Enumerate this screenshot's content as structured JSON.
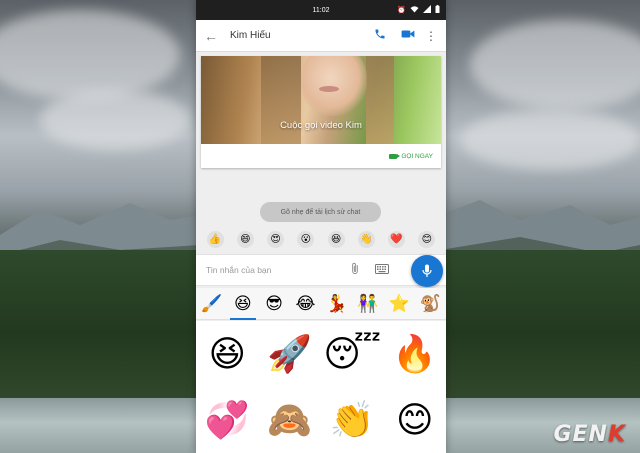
{
  "status_bar": {
    "time": "11:02",
    "icons": [
      "alarm-icon",
      "wifi-icon",
      "signal-icon",
      "battery-icon"
    ]
  },
  "app_bar": {
    "contact_name": "Kim Hiếu",
    "icons": [
      "back-arrow-icon",
      "phone-icon",
      "video-camera-icon",
      "more-vert-icon"
    ],
    "accent_color": "#1976d2"
  },
  "video_call_card": {
    "title": "Cuộc gọi video Kim",
    "action_label": "GỌI NGAY",
    "action_color": "#2e9e44"
  },
  "history_chip": {
    "label": "Gõ nhẹ để tải lịch sử chat"
  },
  "quick_reactions": [
    {
      "name": "thumbs-up-reaction",
      "glyph": "👍"
    },
    {
      "name": "grin-reaction",
      "glyph": "😄"
    },
    {
      "name": "heart-eyes-reaction",
      "glyph": "😍"
    },
    {
      "name": "surprised-reaction",
      "glyph": "😮"
    },
    {
      "name": "laugh-reaction",
      "glyph": "😆"
    },
    {
      "name": "wave-reaction",
      "glyph": "👋"
    },
    {
      "name": "heart-reaction",
      "glyph": "❤️"
    },
    {
      "name": "happy-reaction",
      "glyph": "😊"
    }
  ],
  "composer": {
    "placeholder": "Tin nhắn của bạn",
    "value": "",
    "icons": [
      "paperclip-icon",
      "keyboard-icon",
      "microphone-icon"
    ]
  },
  "sticker_tabs": [
    {
      "name": "brush",
      "glyph": "🖌️",
      "active": false
    },
    {
      "name": "smiley",
      "glyph": "😆",
      "active": true
    },
    {
      "name": "cool",
      "glyph": "😎",
      "active": false
    },
    {
      "name": "tears-of-joy",
      "glyph": "😂",
      "active": false
    },
    {
      "name": "character-1",
      "glyph": "💃",
      "active": false
    },
    {
      "name": "character-2",
      "glyph": "👫",
      "active": false
    },
    {
      "name": "star",
      "glyph": "⭐",
      "active": false
    },
    {
      "name": "character-3",
      "glyph": "🐒",
      "active": false
    }
  ],
  "stickers": [
    {
      "name": "laughing",
      "glyph": "😆"
    },
    {
      "name": "rocket",
      "glyph": "🚀"
    },
    {
      "name": "sleeping",
      "glyph": "😴"
    },
    {
      "name": "fire",
      "glyph": "🔥"
    },
    {
      "name": "revolving-hearts",
      "glyph": "💞"
    },
    {
      "name": "see-no-evil-monkey",
      "glyph": "🙈"
    },
    {
      "name": "clapping-hands",
      "glyph": "👏"
    },
    {
      "name": "blushing",
      "glyph": "😊"
    }
  ],
  "watermark": {
    "text_main": "GEN",
    "text_accent": "K"
  }
}
